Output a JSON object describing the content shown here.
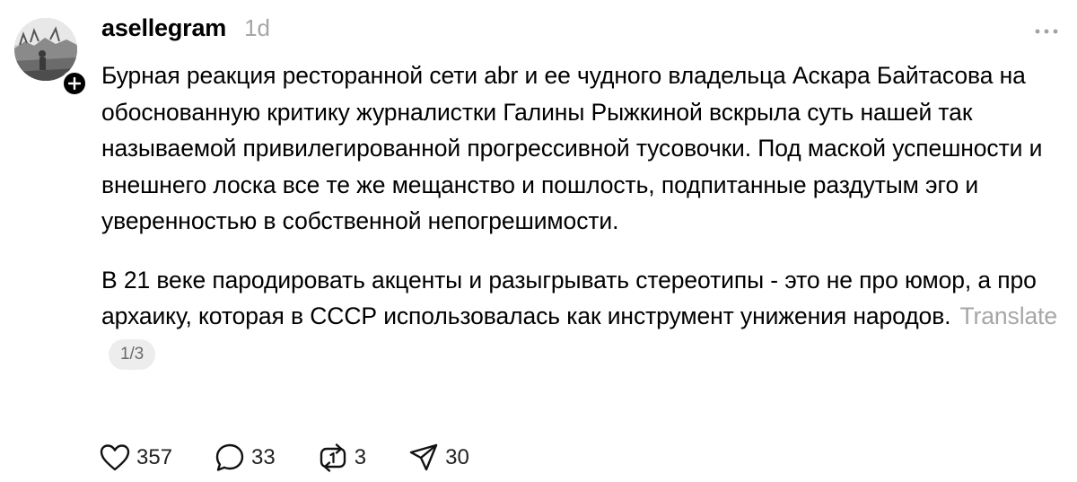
{
  "post": {
    "username": "asellegram",
    "timestamp": "1d",
    "paragraphs": [
      "Бурная реакция ресторанной сети abr и ее чудного владельца Аскара Байтасова на обоснованную критику журналистки Галины Рыжкиной вскрыла суть нашей так называемой привилегированной прогрессивной тусовочки. Под маской успешности и внешнего лоска все те же мещанство и пошлость, подпитанные раздутым эго и уверенностью в собственной непогрешимости.",
      "В 21 веке пародировать акценты и разыгрывать стереотипы - это не про юмор, а про архаику, которая в СССР использовалась как инструмент унижения народов."
    ],
    "translate_label": "Translate",
    "page_counter": "1/3"
  },
  "actions": {
    "likes": "357",
    "replies": "33",
    "reposts": "3",
    "shares": "30"
  },
  "icons": {
    "avatar": "profile-photo",
    "follow": "plus-icon",
    "more": "ellipsis-icon",
    "like": "heart-icon",
    "reply": "speech-bubble-icon",
    "repost": "repost-arrows-icon",
    "share": "paper-plane-icon"
  },
  "colors": {
    "text": "#000000",
    "muted": "#a6a6a6",
    "counter_bg": "#ededed"
  }
}
